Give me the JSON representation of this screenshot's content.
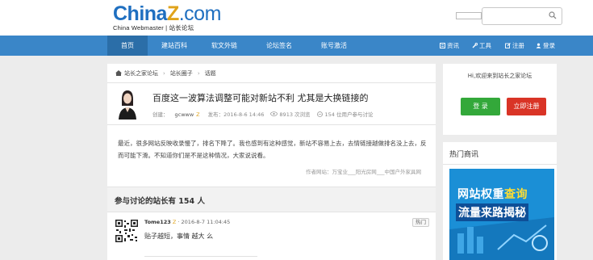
{
  "header": {
    "logo_main_a": "China",
    "logo_main_z": "Z",
    "logo_main_b": ".com",
    "logo_sub": "China Webmaster | 站长论坛"
  },
  "nav": {
    "items": [
      "首页",
      "建站百科",
      "软文外链",
      "论坛签名",
      "账号激活"
    ],
    "right": [
      "资讯",
      "工具",
      "注册",
      "登录"
    ]
  },
  "breadcrumb": [
    "站长之家论坛",
    "站长圈子",
    "话题"
  ],
  "post": {
    "title": "百度这一波算法调整可能对新站不利 尤其是大换链接的",
    "meta_label": "创建：",
    "author": "gcwww",
    "published": "发布：2016-8-6 14:46",
    "views": "8913 次浏览",
    "participants": "154 位用户参与讨论",
    "body": "最近，很多网站反映收录慢了，排名下降了。我也感到有这种感觉，新站不容易上去，去情链接越做排名没上去，反而可能下滑。不知道你们是不是这种情况，大家说说看。",
    "author_site": "作者网站：万宝业___阳光房网___中国户外家具网"
  },
  "discussion": {
    "title": "参与讨论的站长有 154 人"
  },
  "reply": {
    "name": "Tome123",
    "time": "· 2016-8-7 11:04:45",
    "text": "贴子越短，事情 越大 么",
    "badge": "热门"
  },
  "sidebar": {
    "welcome": "Hi,欢迎来到站长之家论坛",
    "login": "登 录",
    "register": "立即注册",
    "hot_title": "热门商讯",
    "banner_a": "网站权重",
    "banner_b": "查询",
    "banner_c": "流量来路揭秘"
  },
  "colors": {
    "nav": "#3a86c8",
    "nav_active": "#2b6ea8",
    "login_btn": "#33a83a",
    "register_btn": "#d93426",
    "banner": "#1b8fd6"
  }
}
